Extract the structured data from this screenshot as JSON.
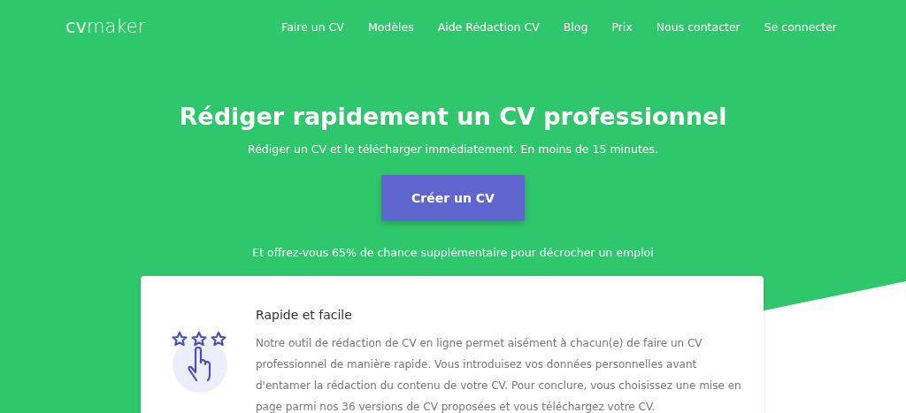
{
  "logo": "**cv**maker",
  "nav": [
    {
      "label": "Faire un CV"
    },
    {
      "label": "Modèles"
    },
    {
      "label": "Aide Rédaction CV"
    },
    {
      "label": "Blog"
    },
    {
      "label": "Prix"
    },
    {
      "label": "Nous contacter"
    },
    {
      "label": "Se connecter"
    }
  ],
  "hero": {
    "title": "Rédiger rapidement un CV professionnel",
    "subtitle": "Rédiger un CV et le télécharger immédiatement. En moins de 15 minutes.",
    "button": "Créer un CV",
    "tagline": "Et offrez-vous 65% de chance supplémentaire pour décrocher un emploi"
  },
  "feature": {
    "title": "Rapide et facile",
    "text": "Notre outil de rédaction de CV en ligne permet aisément à chacun(e) de faire un CV professionnel de manière rapide. Vous introduisez vos données personnelles avant d'entamer la rédaction du contenu de votre CV. Pour conclure, vous choisissez une mise en page parmi nos 36 versions de CV proposées et vous téléchargez votre CV."
  }
}
